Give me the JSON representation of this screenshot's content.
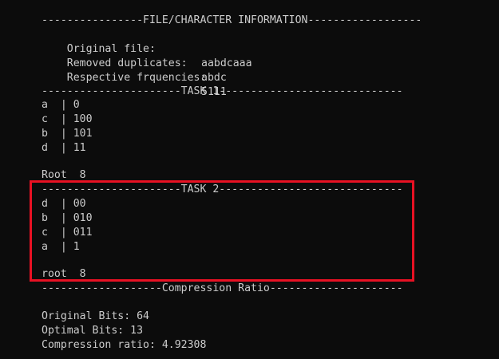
{
  "console": {
    "file_info_header": "----------------FILE/CHARACTER INFORMATION------------------",
    "original_file_label": "Original file:",
    "original_file_value": "aabdcaaa",
    "removed_duplicates_label": "Removed duplicates:",
    "removed_duplicates_value": "abdc",
    "frequencies_label": "Respective frquencies:",
    "frequencies_value": "5111",
    "task1_header": "----------------------TASK 1-----------------------------",
    "task1_rows": [
      "a  | 0",
      "c  | 100",
      "b  | 101",
      "d  | 11"
    ],
    "task1_root": "Root  8",
    "task2_header": "----------------------TASK 2-----------------------------",
    "task2_rows": [
      "d  | 00",
      "b  | 010",
      "c  | 011",
      "a  | 1"
    ],
    "task2_root": "root  8",
    "compression_header": "-------------------Compression Ratio---------------------",
    "original_bits": "Original Bits: 64",
    "optimal_bits": "Optimal Bits: 13",
    "compression_ratio": "Compression ratio: 4.92308"
  },
  "highlight_color": "#e81123"
}
